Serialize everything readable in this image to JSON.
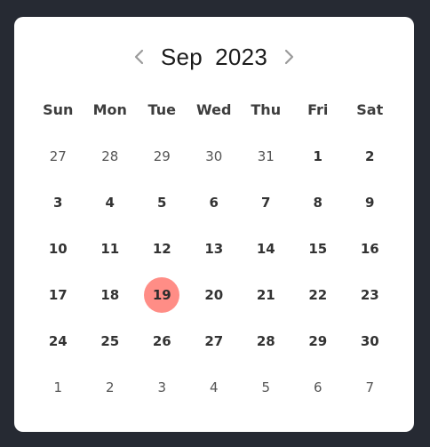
{
  "calendar": {
    "month": "Sep",
    "year": "2023",
    "prev_icon": "chevron-left-icon",
    "next_icon": "chevron-right-icon",
    "weekdays": [
      "Sun",
      "Mon",
      "Tue",
      "Wed",
      "Thu",
      "Fri",
      "Sat"
    ],
    "days": [
      {
        "label": "27",
        "type": "other"
      },
      {
        "label": "28",
        "type": "other"
      },
      {
        "label": "29",
        "type": "other"
      },
      {
        "label": "30",
        "type": "other"
      },
      {
        "label": "31",
        "type": "other"
      },
      {
        "label": "1",
        "type": "current"
      },
      {
        "label": "2",
        "type": "current"
      },
      {
        "label": "3",
        "type": "current"
      },
      {
        "label": "4",
        "type": "current"
      },
      {
        "label": "5",
        "type": "current"
      },
      {
        "label": "6",
        "type": "current"
      },
      {
        "label": "7",
        "type": "current"
      },
      {
        "label": "8",
        "type": "current"
      },
      {
        "label": "9",
        "type": "current"
      },
      {
        "label": "10",
        "type": "current"
      },
      {
        "label": "11",
        "type": "current"
      },
      {
        "label": "12",
        "type": "current"
      },
      {
        "label": "13",
        "type": "current"
      },
      {
        "label": "14",
        "type": "current"
      },
      {
        "label": "15",
        "type": "current"
      },
      {
        "label": "16",
        "type": "current"
      },
      {
        "label": "17",
        "type": "current"
      },
      {
        "label": "18",
        "type": "current"
      },
      {
        "label": "19",
        "type": "selected"
      },
      {
        "label": "20",
        "type": "current"
      },
      {
        "label": "21",
        "type": "current"
      },
      {
        "label": "22",
        "type": "current"
      },
      {
        "label": "23",
        "type": "current"
      },
      {
        "label": "24",
        "type": "current"
      },
      {
        "label": "25",
        "type": "current"
      },
      {
        "label": "26",
        "type": "current"
      },
      {
        "label": "27",
        "type": "current"
      },
      {
        "label": "28",
        "type": "current"
      },
      {
        "label": "29",
        "type": "current"
      },
      {
        "label": "30",
        "type": "current"
      },
      {
        "label": "1",
        "type": "other"
      },
      {
        "label": "2",
        "type": "other"
      },
      {
        "label": "3",
        "type": "other"
      },
      {
        "label": "4",
        "type": "other"
      },
      {
        "label": "5",
        "type": "other"
      },
      {
        "label": "6",
        "type": "other"
      },
      {
        "label": "7",
        "type": "other"
      }
    ]
  },
  "colors": {
    "background": "#262a33",
    "card": "#ffffff",
    "selected": "#ff8d86",
    "chevron": "#9a9a9a"
  }
}
